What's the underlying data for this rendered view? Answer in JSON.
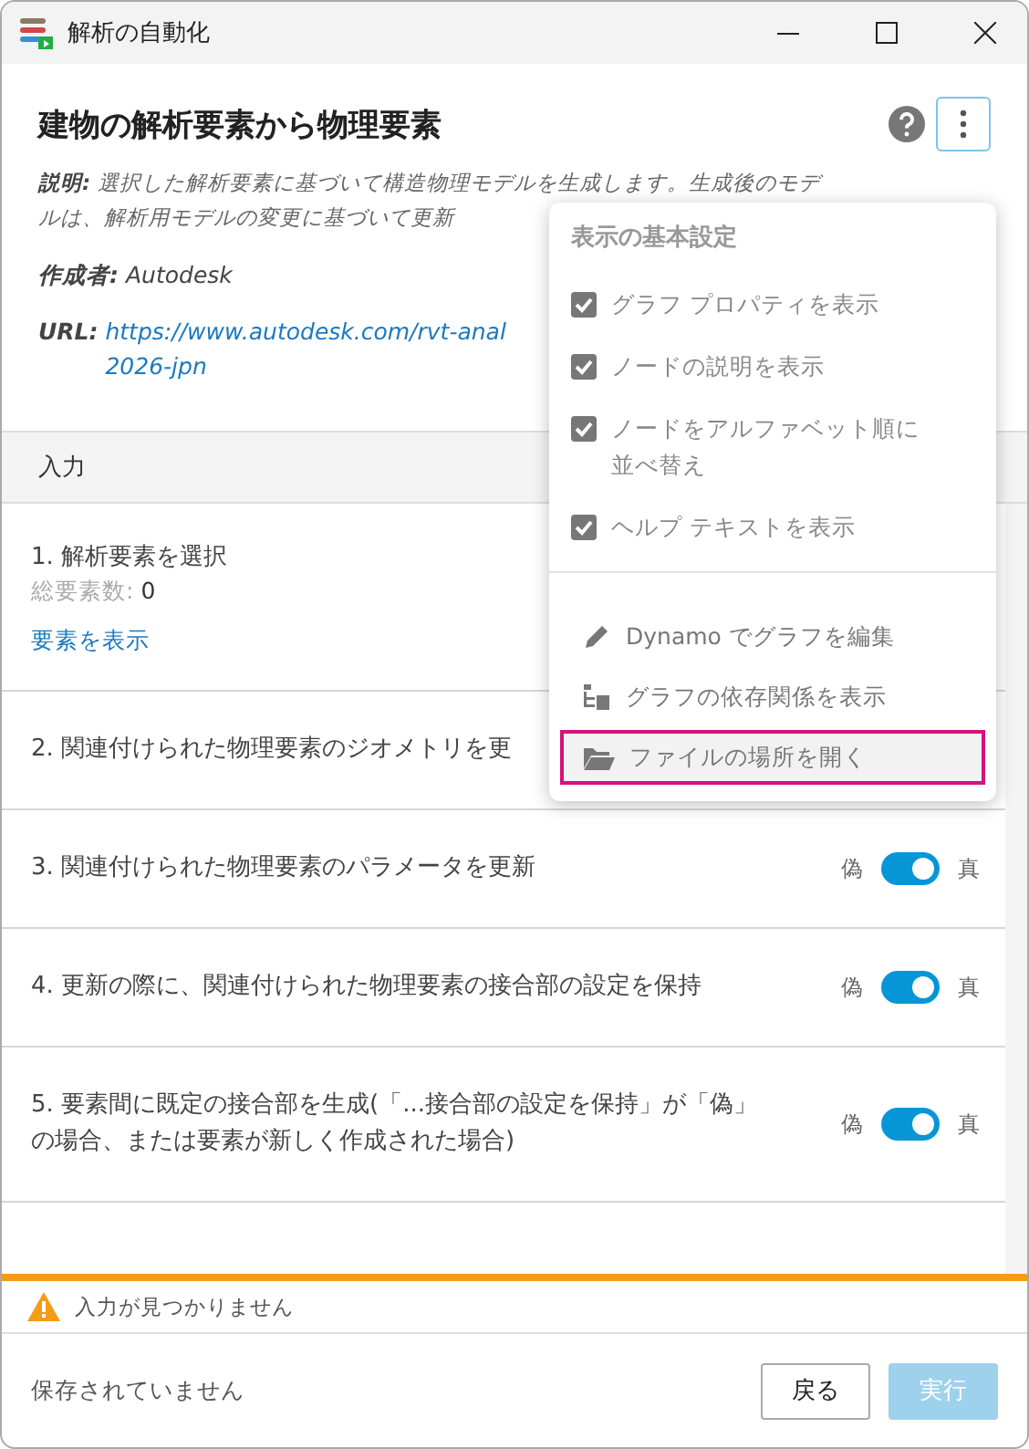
{
  "window": {
    "title": "解析の自動化"
  },
  "header": {
    "title": "建物の解析要素から物理要素",
    "description_label": "説明:",
    "description_lines": [
      "選択した解析要素に基づいて構造物理モデルを生成します。生成後のモデ",
      "ルは、解析用モデルの変更に基づいて更新"
    ],
    "author_label": "作成者:",
    "author": "Autodesk",
    "url_label": "URL:",
    "url_lines": [
      "https://www.autodesk.com/rvt-anal",
      "2026-jpn"
    ]
  },
  "section": {
    "title": "入力"
  },
  "inputs": [
    {
      "kind": "selection",
      "label": "1. 解析要素を選択",
      "count_label": "総要素数:",
      "count": "0",
      "link": "要素を表示"
    },
    {
      "kind": "plain",
      "label": "2. 関連付けられた物理要素のジオメトリを更"
    },
    {
      "kind": "toggle",
      "label": "3. 関連付けられた物理要素のパラメータを更新",
      "off_label": "偽",
      "on_label": "真",
      "on": true
    },
    {
      "kind": "toggle",
      "label": "4. 更新の際に、関連付けられた物理要素の接合部の設定を保持",
      "off_label": "偽",
      "on_label": "真",
      "on": true
    },
    {
      "kind": "toggle",
      "label": "5. 要素間に既定の接合部を生成(「...接合部の設定を保持」が「偽」の場合、または要素が新しく作成された場合)",
      "off_label": "偽",
      "on_label": "真",
      "on": true
    }
  ],
  "menu": {
    "title": "表示の基本設定",
    "options": [
      {
        "label": "グラフ プロパティを表示",
        "checked": true
      },
      {
        "label": "ノードの説明を表示",
        "checked": true
      },
      {
        "label": "ノードをアルファベット順に並べ替え",
        "checked": true
      },
      {
        "label": "ヘルプ テキストを表示",
        "checked": true
      }
    ],
    "actions": [
      {
        "kind": "edit",
        "label": "Dynamo でグラフを編集",
        "selected": false
      },
      {
        "kind": "tree",
        "label": "グラフの依存関係を表示",
        "selected": false
      },
      {
        "kind": "folder",
        "label": "ファイルの場所を開く",
        "selected": true
      }
    ]
  },
  "warning": {
    "text": "入力が見つかりません"
  },
  "footer": {
    "status": "保存されていません",
    "buttons": [
      {
        "label": "戻る",
        "kind": "secondary",
        "disabled": false
      },
      {
        "label": "実行",
        "kind": "primary",
        "disabled": true
      }
    ]
  }
}
